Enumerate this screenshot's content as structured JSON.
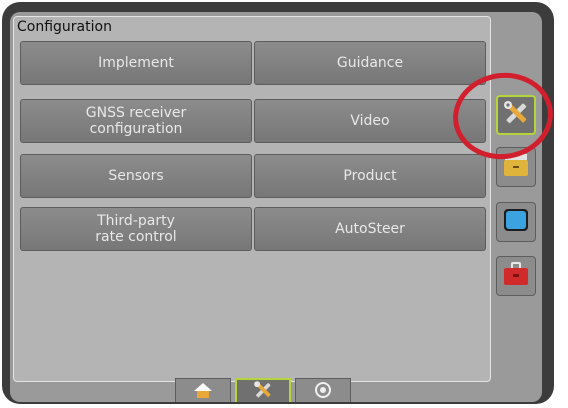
{
  "panel": {
    "title": "Configuration"
  },
  "buttons": {
    "implement": "Implement",
    "guidance": "Guidance",
    "gnss": "GNSS receiver\nconfiguration",
    "video": "Video",
    "sensors": "Sensors",
    "product": "Product",
    "third_party": "Third-party\nrate control",
    "autosteer": "AutoSteer"
  },
  "side_tabs": [
    {
      "icon": "tools-icon",
      "active": true
    },
    {
      "icon": "yellow-drawer-icon",
      "active": false
    },
    {
      "icon": "blue-screen-icon",
      "active": false
    },
    {
      "icon": "red-toolbox-icon",
      "active": false
    }
  ],
  "bottom_tabs": [
    {
      "icon": "home-icon",
      "active": false
    },
    {
      "icon": "tools-icon",
      "active": true
    },
    {
      "icon": "camera-lens-icon",
      "active": false
    }
  ],
  "colors": {
    "active_border": "#b6d53a",
    "highlight": "#d11f2d"
  }
}
